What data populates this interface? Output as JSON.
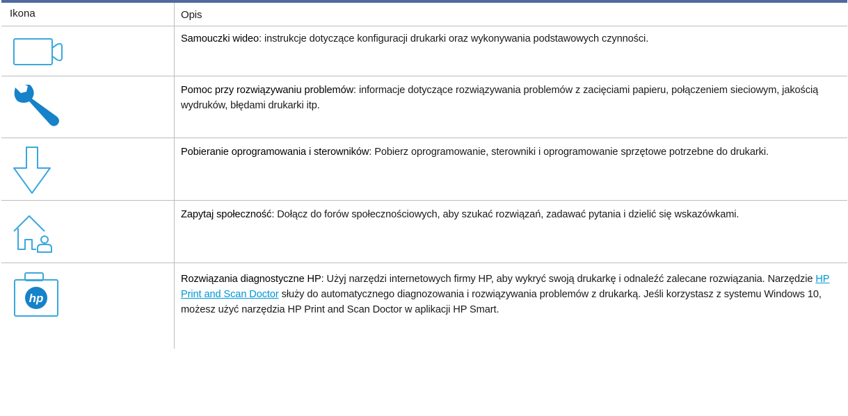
{
  "table": {
    "header": {
      "icon_col": "Ikona",
      "desc_col": "Opis"
    },
    "rows": [
      {
        "icon": "video-camera-icon",
        "term": "Samouczki wideo",
        "text": ": instrukcje dotyczące konfiguracji drukarki oraz wykonywania podstawowych czynności."
      },
      {
        "icon": "wrench-icon",
        "term": "Pomoc przy rozwiązywaniu problemów",
        "text": ": informacje dotyczące rozwiązywania problemów z zacięciami papieru, połączeniem sieciowym, jakością wydruków, błędami drukarki itp."
      },
      {
        "icon": "download-arrow-icon",
        "term": "Pobieranie oprogramowania i sterowników",
        "text": ": Pobierz oprogramowanie, sterowniki i oprogramowanie sprzętowe potrzebne do drukarki."
      },
      {
        "icon": "community-house-icon",
        "term": "Zapytaj społeczność",
        "text": ": Dołącz do forów społecznościowych, aby szukać rozwiązań, zadawać pytania i dzielić się wskazówkami."
      },
      {
        "icon": "hp-diagnostic-case-icon",
        "term": "Rozwiązania diagnostyczne HP",
        "text_before": ": Użyj narzędzi internetowych firmy HP, aby wykryć swoją drukarkę i odnaleźć zalecane rozwiązania. Narzędzie ",
        "link": "HP Print and Scan Doctor",
        "text_after": " służy do automatycznego diagnozowania i rozwiązywania problemów z drukarką. Jeśli korzystasz z systemu Windows 10, możesz użyć narzędzia HP Print and Scan Doctor w aplikacji HP Smart.",
        "logo_text": "hp"
      }
    ]
  },
  "colors": {
    "icon_blue": "#3aa7de",
    "header_rule": "#4e6a9e",
    "link": "#0096d6"
  }
}
